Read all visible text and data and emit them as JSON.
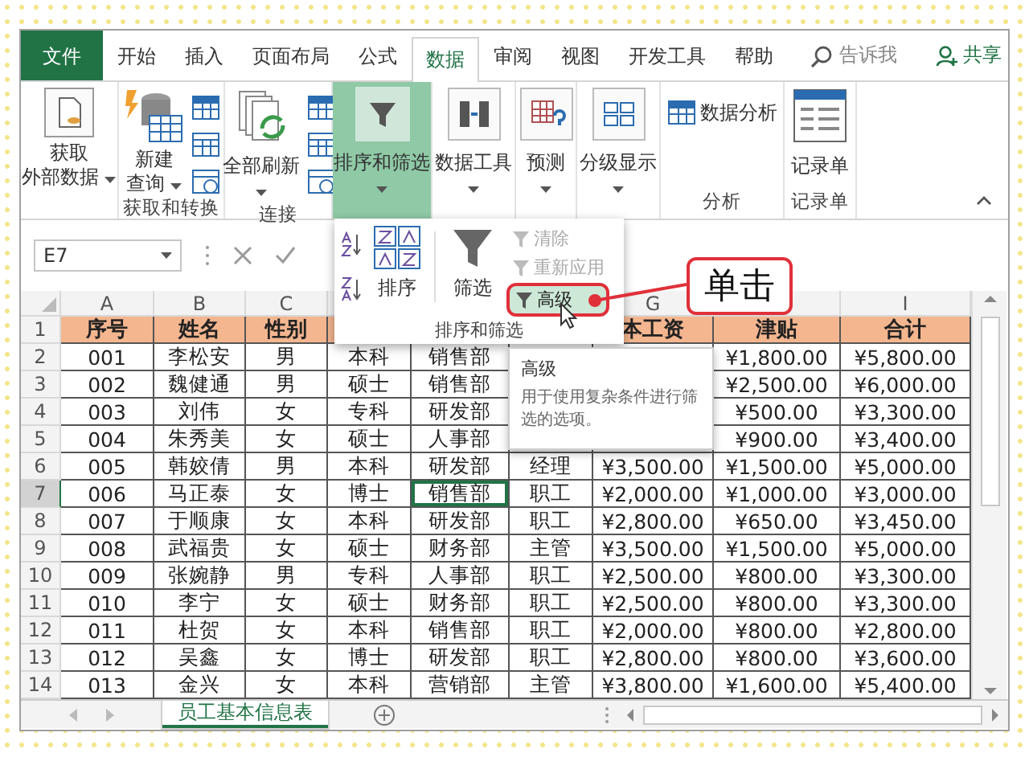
{
  "tabs": [
    {
      "label": "文件",
      "kind": "file",
      "selected": false
    },
    {
      "label": "开始",
      "kind": "tab",
      "selected": false
    },
    {
      "label": "插入",
      "kind": "tab",
      "selected": false
    },
    {
      "label": "页面布局",
      "kind": "tab",
      "selected": false
    },
    {
      "label": "公式",
      "kind": "tab",
      "selected": false
    },
    {
      "label": "数据",
      "kind": "tab",
      "selected": true
    },
    {
      "label": "审阅",
      "kind": "tab",
      "selected": false
    },
    {
      "label": "视图",
      "kind": "tab",
      "selected": false
    },
    {
      "label": "开发工具",
      "kind": "tab",
      "selected": false
    },
    {
      "label": "帮助",
      "kind": "tab",
      "selected": false
    }
  ],
  "tell_me": "告诉我",
  "share": "共享",
  "ribbon_groups": [
    {
      "selected": false,
      "items": [
        {
          "kind": "large",
          "lines": [
            "获取",
            "外部数据"
          ],
          "dropdown": true
        }
      ]
    },
    {
      "label": "获取和转换",
      "selected": false,
      "items": [
        {
          "kind": "large",
          "lines": [
            "新建",
            "查询"
          ],
          "dropdown": true
        },
        {
          "kind": "icon_column"
        }
      ]
    },
    {
      "label": "连接",
      "selected": false,
      "items": [
        {
          "kind": "large",
          "lines": [
            "全部刷新"
          ],
          "dropdown": true
        },
        {
          "kind": "icon_column"
        }
      ]
    },
    {
      "selected": true,
      "items": [
        {
          "kind": "large",
          "lines": [
            "排序和筛选"
          ],
          "dropdown": true
        }
      ]
    },
    {
      "selected": false,
      "items": [
        {
          "kind": "large",
          "lines": [
            "数据工具"
          ],
          "dropdown": true
        }
      ]
    },
    {
      "selected": false,
      "items": [
        {
          "kind": "large",
          "lines": [
            "预测"
          ],
          "dropdown": true
        }
      ]
    },
    {
      "selected": false,
      "items": [
        {
          "kind": "large",
          "lines": [
            "分级显示"
          ],
          "dropdown": true
        }
      ]
    },
    {
      "label": "分析",
      "selected": false,
      "items": [
        {
          "kind": "small_text",
          "lines": [
            "数据分析"
          ]
        }
      ]
    },
    {
      "label": "记录单",
      "selected": false,
      "items": [
        {
          "kind": "large",
          "lines": [
            "记录单"
          ],
          "dropdown": false
        }
      ]
    }
  ],
  "name_box": "E7",
  "columns": [
    "A",
    "B",
    "C",
    null,
    null,
    null,
    "G",
    null,
    "I"
  ],
  "rows": [
    {
      "number": "1",
      "kind": "header",
      "selected": false,
      "cells": [
        "序号",
        "姓名",
        "性别",
        null,
        null,
        null,
        "本工资",
        "津贴",
        "合计"
      ]
    },
    {
      "number": "2",
      "kind": "data",
      "selected": false,
      "cells": [
        "001",
        "李松安",
        "男",
        "本科",
        "销售部",
        null,
        null,
        "¥1,800.00",
        "¥5,800.00"
      ]
    },
    {
      "number": "3",
      "kind": "data",
      "selected": false,
      "cells": [
        "002",
        "魏健通",
        "男",
        "硕士",
        "销售部",
        null,
        null,
        "¥2,500.00",
        "¥6,000.00"
      ]
    },
    {
      "number": "4",
      "kind": "data",
      "selected": false,
      "cells": [
        "003",
        "刘伟",
        "女",
        "专科",
        "研发部",
        null,
        null,
        "¥500.00",
        "¥3,300.00"
      ]
    },
    {
      "number": "5",
      "kind": "data",
      "selected": false,
      "cells": [
        "004",
        "朱秀美",
        "女",
        "硕士",
        "人事部",
        null,
        null,
        "¥900.00",
        "¥3,400.00"
      ]
    },
    {
      "number": "6",
      "kind": "data",
      "selected": false,
      "cells": [
        "005",
        "韩姣倩",
        "男",
        "本科",
        "研发部",
        "经理",
        "¥3,500.00",
        "¥1,500.00",
        "¥5,000.00"
      ]
    },
    {
      "number": "7",
      "kind": "data",
      "selected": true,
      "cells": [
        "006",
        "马正泰",
        "女",
        "博士",
        {
          "text": "销售部",
          "selected": true
        },
        "职工",
        "¥2,000.00",
        "¥1,000.00",
        "¥3,000.00"
      ]
    },
    {
      "number": "8",
      "kind": "data",
      "selected": false,
      "cells": [
        "007",
        "于顺康",
        "女",
        "本科",
        "研发部",
        "职工",
        "¥2,800.00",
        "¥650.00",
        "¥3,450.00"
      ]
    },
    {
      "number": "9",
      "kind": "data",
      "selected": false,
      "cells": [
        "008",
        "武福贵",
        "女",
        "硕士",
        "财务部",
        "主管",
        "¥3,500.00",
        "¥1,500.00",
        "¥5,000.00"
      ]
    },
    {
      "number": "10",
      "kind": "data",
      "selected": false,
      "cells": [
        "009",
        "张婉静",
        "男",
        "专科",
        "人事部",
        "职工",
        "¥2,500.00",
        "¥800.00",
        "¥3,300.00"
      ]
    },
    {
      "number": "11",
      "kind": "data",
      "selected": false,
      "cells": [
        "010",
        "李宁",
        "女",
        "硕士",
        "财务部",
        "职工",
        "¥2,500.00",
        "¥800.00",
        "¥3,300.00"
      ]
    },
    {
      "number": "12",
      "kind": "data",
      "selected": false,
      "cells": [
        "011",
        "杜贺",
        "女",
        "本科",
        "销售部",
        "职工",
        "¥2,000.00",
        "¥800.00",
        "¥2,800.00"
      ]
    },
    {
      "number": "13",
      "kind": "data",
      "selected": false,
      "cells": [
        "012",
        "吴鑫",
        "女",
        "博士",
        "研发部",
        "职工",
        "¥2,800.00",
        "¥800.00",
        "¥3,600.00"
      ]
    },
    {
      "number": "14",
      "kind": "data",
      "selected": false,
      "cells": [
        "013",
        "金兴",
        "女",
        "本科",
        "营销部",
        "主管",
        "¥3,800.00",
        "¥1,600.00",
        "¥5,400.00"
      ]
    }
  ],
  "sort_filter_menu": {
    "sort_label": "排序",
    "filter_label": "筛选",
    "group_label": "排序和筛选",
    "actions": [
      {
        "label": "清除",
        "disabled": true,
        "highlighted": false
      },
      {
        "label": "重新应用",
        "disabled": true,
        "highlighted": false
      },
      {
        "label": "高级",
        "disabled": false,
        "highlighted": true
      }
    ]
  },
  "tooltip": {
    "title": "高级",
    "text": "用于使用复杂条件进行筛选的选项。"
  },
  "callout": {
    "text": "单击"
  },
  "sheet_tabs": [
    {
      "label": "员工基本信息表",
      "selected": true
    }
  ]
}
